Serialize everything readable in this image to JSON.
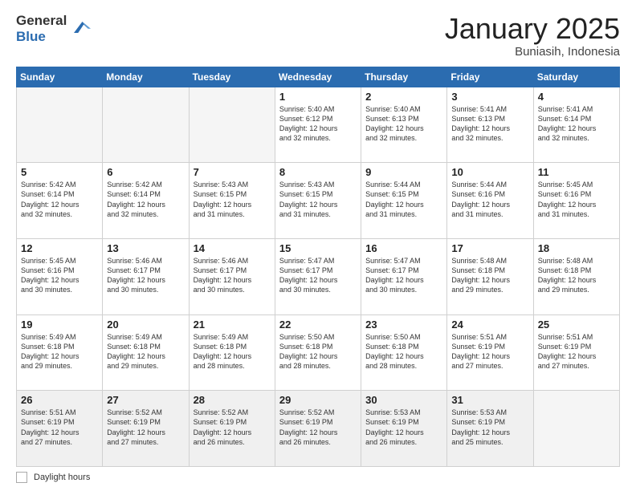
{
  "logo": {
    "general": "General",
    "blue": "Blue"
  },
  "title": {
    "month_year": "January 2025",
    "location": "Buniasih, Indonesia"
  },
  "days_of_week": [
    "Sunday",
    "Monday",
    "Tuesday",
    "Wednesday",
    "Thursday",
    "Friday",
    "Saturday"
  ],
  "footer": {
    "label": "Daylight hours"
  },
  "weeks": [
    [
      {
        "day": "",
        "info": ""
      },
      {
        "day": "",
        "info": ""
      },
      {
        "day": "",
        "info": ""
      },
      {
        "day": "1",
        "info": "Sunrise: 5:40 AM\nSunset: 6:12 PM\nDaylight: 12 hours\nand 32 minutes."
      },
      {
        "day": "2",
        "info": "Sunrise: 5:40 AM\nSunset: 6:13 PM\nDaylight: 12 hours\nand 32 minutes."
      },
      {
        "day": "3",
        "info": "Sunrise: 5:41 AM\nSunset: 6:13 PM\nDaylight: 12 hours\nand 32 minutes."
      },
      {
        "day": "4",
        "info": "Sunrise: 5:41 AM\nSunset: 6:14 PM\nDaylight: 12 hours\nand 32 minutes."
      }
    ],
    [
      {
        "day": "5",
        "info": "Sunrise: 5:42 AM\nSunset: 6:14 PM\nDaylight: 12 hours\nand 32 minutes."
      },
      {
        "day": "6",
        "info": "Sunrise: 5:42 AM\nSunset: 6:14 PM\nDaylight: 12 hours\nand 32 minutes."
      },
      {
        "day": "7",
        "info": "Sunrise: 5:43 AM\nSunset: 6:15 PM\nDaylight: 12 hours\nand 31 minutes."
      },
      {
        "day": "8",
        "info": "Sunrise: 5:43 AM\nSunset: 6:15 PM\nDaylight: 12 hours\nand 31 minutes."
      },
      {
        "day": "9",
        "info": "Sunrise: 5:44 AM\nSunset: 6:15 PM\nDaylight: 12 hours\nand 31 minutes."
      },
      {
        "day": "10",
        "info": "Sunrise: 5:44 AM\nSunset: 6:16 PM\nDaylight: 12 hours\nand 31 minutes."
      },
      {
        "day": "11",
        "info": "Sunrise: 5:45 AM\nSunset: 6:16 PM\nDaylight: 12 hours\nand 31 minutes."
      }
    ],
    [
      {
        "day": "12",
        "info": "Sunrise: 5:45 AM\nSunset: 6:16 PM\nDaylight: 12 hours\nand 30 minutes."
      },
      {
        "day": "13",
        "info": "Sunrise: 5:46 AM\nSunset: 6:17 PM\nDaylight: 12 hours\nand 30 minutes."
      },
      {
        "day": "14",
        "info": "Sunrise: 5:46 AM\nSunset: 6:17 PM\nDaylight: 12 hours\nand 30 minutes."
      },
      {
        "day": "15",
        "info": "Sunrise: 5:47 AM\nSunset: 6:17 PM\nDaylight: 12 hours\nand 30 minutes."
      },
      {
        "day": "16",
        "info": "Sunrise: 5:47 AM\nSunset: 6:17 PM\nDaylight: 12 hours\nand 30 minutes."
      },
      {
        "day": "17",
        "info": "Sunrise: 5:48 AM\nSunset: 6:18 PM\nDaylight: 12 hours\nand 29 minutes."
      },
      {
        "day": "18",
        "info": "Sunrise: 5:48 AM\nSunset: 6:18 PM\nDaylight: 12 hours\nand 29 minutes."
      }
    ],
    [
      {
        "day": "19",
        "info": "Sunrise: 5:49 AM\nSunset: 6:18 PM\nDaylight: 12 hours\nand 29 minutes."
      },
      {
        "day": "20",
        "info": "Sunrise: 5:49 AM\nSunset: 6:18 PM\nDaylight: 12 hours\nand 29 minutes."
      },
      {
        "day": "21",
        "info": "Sunrise: 5:49 AM\nSunset: 6:18 PM\nDaylight: 12 hours\nand 28 minutes."
      },
      {
        "day": "22",
        "info": "Sunrise: 5:50 AM\nSunset: 6:18 PM\nDaylight: 12 hours\nand 28 minutes."
      },
      {
        "day": "23",
        "info": "Sunrise: 5:50 AM\nSunset: 6:18 PM\nDaylight: 12 hours\nand 28 minutes."
      },
      {
        "day": "24",
        "info": "Sunrise: 5:51 AM\nSunset: 6:19 PM\nDaylight: 12 hours\nand 27 minutes."
      },
      {
        "day": "25",
        "info": "Sunrise: 5:51 AM\nSunset: 6:19 PM\nDaylight: 12 hours\nand 27 minutes."
      }
    ],
    [
      {
        "day": "26",
        "info": "Sunrise: 5:51 AM\nSunset: 6:19 PM\nDaylight: 12 hours\nand 27 minutes."
      },
      {
        "day": "27",
        "info": "Sunrise: 5:52 AM\nSunset: 6:19 PM\nDaylight: 12 hours\nand 27 minutes."
      },
      {
        "day": "28",
        "info": "Sunrise: 5:52 AM\nSunset: 6:19 PM\nDaylight: 12 hours\nand 26 minutes."
      },
      {
        "day": "29",
        "info": "Sunrise: 5:52 AM\nSunset: 6:19 PM\nDaylight: 12 hours\nand 26 minutes."
      },
      {
        "day": "30",
        "info": "Sunrise: 5:53 AM\nSunset: 6:19 PM\nDaylight: 12 hours\nand 26 minutes."
      },
      {
        "day": "31",
        "info": "Sunrise: 5:53 AM\nSunset: 6:19 PM\nDaylight: 12 hours\nand 25 minutes."
      },
      {
        "day": "",
        "info": ""
      }
    ]
  ]
}
